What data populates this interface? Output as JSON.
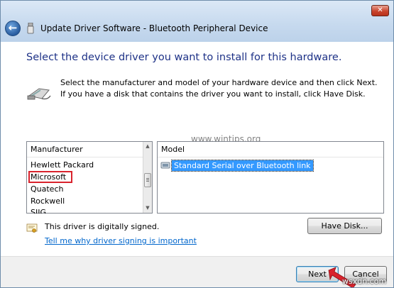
{
  "window": {
    "title": "Update Driver Software - Bluetooth Peripheral Device",
    "close_glyph": "✕",
    "back_glyph": "←"
  },
  "content": {
    "heading": "Select the device driver you want to install for this hardware.",
    "description": "Select the manufacturer and model of your hardware device and then click Next. If you have a disk that contains the driver you want to install, click Have Disk."
  },
  "manufacturer_list": {
    "header": "Manufacturer",
    "items": [
      "Hewlett Packard",
      "Microsoft",
      "Quatech",
      "Rockwell",
      "SIIG"
    ],
    "highlighted_item": "Microsoft"
  },
  "model_list": {
    "header": "Model",
    "items": [
      "Standard Serial over Bluetooth link"
    ],
    "selected_item": "Standard Serial over Bluetooth link"
  },
  "signing": {
    "status": "This driver is digitally signed.",
    "link": "Tell me why driver signing is important"
  },
  "buttons": {
    "have_disk": "Have Disk...",
    "next": "Next",
    "cancel": "Cancel"
  },
  "watermarks": {
    "center": "www.wintips.org",
    "corner": "wsxdn.com"
  },
  "colors": {
    "heading": "#1e3287",
    "selection": "#3399ff",
    "highlight_box": "#d9232d",
    "link": "#0066cc",
    "arrow": "#d9232d"
  },
  "icons": {
    "back": "back-arrow-icon",
    "usb": "usb-device-icon",
    "hardware": "hardware-cable-icon",
    "model": "serial-port-icon",
    "signed": "certificate-icon"
  }
}
